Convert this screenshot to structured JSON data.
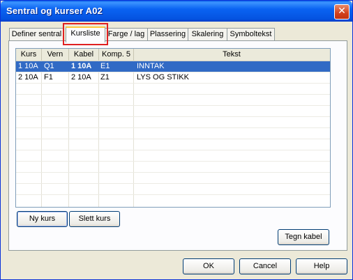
{
  "window": {
    "title": "Sentral og kurser  A02",
    "close_icon": "close-icon"
  },
  "tabs": [
    {
      "label": "Definer sentral"
    },
    {
      "label": "Kursliste"
    },
    {
      "label": "Farge / lag"
    },
    {
      "label": "Plassering"
    },
    {
      "label": "Skalering"
    },
    {
      "label": "Symboltekst"
    }
  ],
  "table": {
    "columns": [
      "Kurs",
      "Vern",
      "Kabel",
      "Komp. 5",
      "Tekst"
    ],
    "rows": [
      {
        "kurs": "1 10A",
        "vern": "Q1",
        "kabel": "1 10A",
        "komp": "E1",
        "tekst": "INNTAK",
        "selected": true
      },
      {
        "kurs": "2 10A",
        "vern": "F1",
        "kabel": "2 10A",
        "komp": "Z1",
        "tekst": "LYS OG STIKK",
        "selected": false
      }
    ]
  },
  "buttons": {
    "new_course": "Ny kurs",
    "delete_course": "Slett kurs",
    "draw_cable": "Tegn kabel",
    "ok": "OK",
    "cancel": "Cancel",
    "help": "Help"
  },
  "colors": {
    "selection": "#316ac5",
    "title_bar": "#0a5fe8",
    "tab_highlight": "#e02020"
  }
}
